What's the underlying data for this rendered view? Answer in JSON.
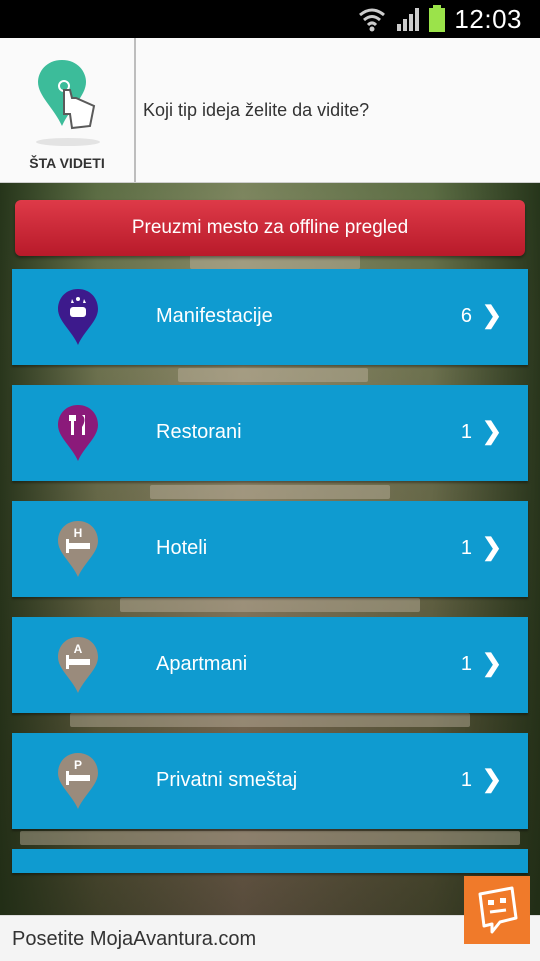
{
  "status_bar": {
    "time": "12:03",
    "icons": [
      "wifi-icon",
      "signal-icon",
      "battery-icon"
    ]
  },
  "header": {
    "logo_label": "ŠTA VIDETI",
    "prompt": "Koji tip ideja želite da vidite?"
  },
  "offline_button": {
    "label": "Preuzmi mesto za offline pregled"
  },
  "categories": [
    {
      "label": "Manifestacije",
      "count": "6",
      "icon": "events-icon",
      "color": "#3d1a8c"
    },
    {
      "label": "Restorani",
      "count": "1",
      "icon": "restaurant-icon",
      "color": "#8b1a7a"
    },
    {
      "label": "Hoteli",
      "count": "1",
      "icon": "hotel-icon",
      "color": "#9a8b7c",
      "badge": "H"
    },
    {
      "label": "Apartmani",
      "count": "1",
      "icon": "apartment-icon",
      "color": "#9a8b7c",
      "badge": "A"
    },
    {
      "label": "Privatni smeštaj",
      "count": "1",
      "icon": "private-accommodation-icon",
      "color": "#9a8b7c",
      "badge": "P"
    }
  ],
  "footer": {
    "text": "Posetite MojaAvantura.com"
  },
  "colors": {
    "row": "#0f9bd0",
    "button": "#c8202f",
    "chat": "#f07a2a"
  }
}
